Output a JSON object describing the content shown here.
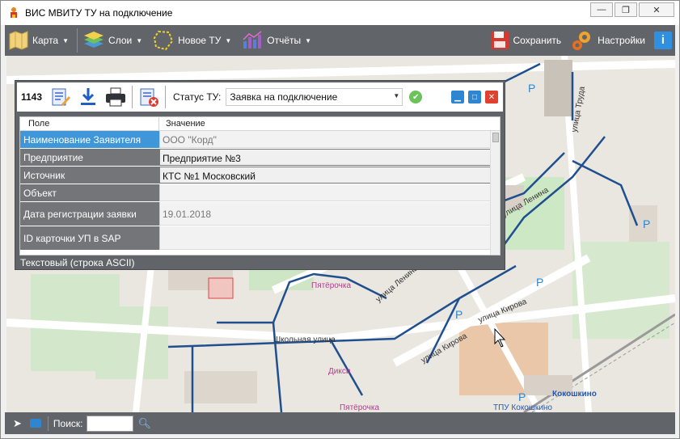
{
  "window": {
    "title": "ВИС МВИТУ ТУ на подключение",
    "controls": {
      "minimize": "—",
      "restore": "❐",
      "close": "✕"
    }
  },
  "toolbar": {
    "items": [
      {
        "label": "Карта",
        "icon": "map-icon"
      },
      {
        "label": "Слои",
        "icon": "layers-icon"
      },
      {
        "label": "Новое ТУ",
        "icon": "new-polygon-icon"
      },
      {
        "label": "Отчёты",
        "icon": "reports-chart-icon"
      }
    ],
    "save_label": "Сохранить",
    "settings_label": "Настройки",
    "info_label": "i"
  },
  "panel": {
    "number": "1143",
    "status_label": "Статус ТУ:",
    "status_value": "Заявка на подключение",
    "columns": {
      "field": "Поле",
      "value": "Значение"
    },
    "rows": [
      {
        "key": "Наименование Заявителя",
        "value": "ООО \"Корд\""
      },
      {
        "key": "Предприятие",
        "value": "Предприятие №3"
      },
      {
        "key": "Источник",
        "value": "КТС №1 Московский"
      },
      {
        "key": "Объект",
        "value": ""
      },
      {
        "key": "Дата регистрации заявки",
        "value": "19.01.2018"
      },
      {
        "key": "ID карточки УП в SAP",
        "value": ""
      }
    ],
    "footer": "Текстовый (строка ASCII)"
  },
  "map": {
    "labels": [
      "улица Труда",
      "улица Ленина",
      "Пятёрочка",
      "улица Ленина",
      "улица Кирова",
      "улица Кирова",
      "Школьная улица",
      "Дикси",
      "Пятёрочка",
      "Кокошкино",
      "ТПУ Кокошкино"
    ]
  },
  "statusbar": {
    "search_label": "Поиск:"
  },
  "colors": {
    "toolbar_bg": "#616468",
    "accent_blue": "#3f96d8",
    "network_line": "#1f4f8f"
  }
}
